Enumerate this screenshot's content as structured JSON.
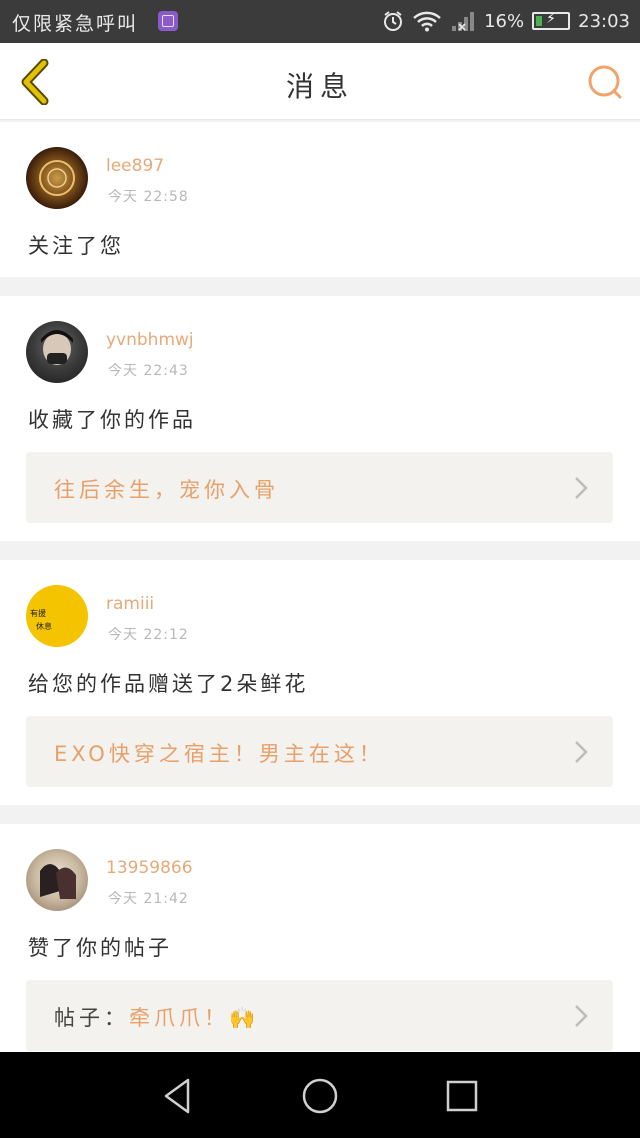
{
  "status_bar": {
    "left_text": "仅限紧急呼叫",
    "battery": "16%",
    "time": "23:03",
    "icons": [
      "image-icon",
      "alarm-icon",
      "wifi-icon",
      "signal-icon",
      "battery-icon"
    ]
  },
  "header": {
    "title": "消息",
    "back_icon": "chevron-left-icon",
    "search_icon": "search-icon"
  },
  "colors": {
    "accent": "#e8a878",
    "back": "#d4b800",
    "link_bg": "#f3f2ee"
  },
  "messages": [
    {
      "username": "lee897",
      "time": "今天 22:58",
      "action": "关注了您"
    },
    {
      "username": "yvnbhmwj",
      "time": "今天 22:43",
      "action": "收藏了你的作品",
      "link": "往后余生，宠你入骨"
    },
    {
      "username": "ramiii",
      "time": "今天 22:12",
      "action": "给您的作品赠送了2朵鲜花",
      "link": "EXO快穿之宿主！男主在这！",
      "avatar_text": [
        "有援",
        "休息"
      ]
    },
    {
      "username": "13959866",
      "time": "今天 21:42",
      "action": "赞了你的帖子",
      "link_prefix": "帖子：",
      "link": "牵爪爪！🙌"
    }
  ],
  "nav": [
    "back-triangle-icon",
    "home-circle-icon",
    "recents-square-icon"
  ]
}
